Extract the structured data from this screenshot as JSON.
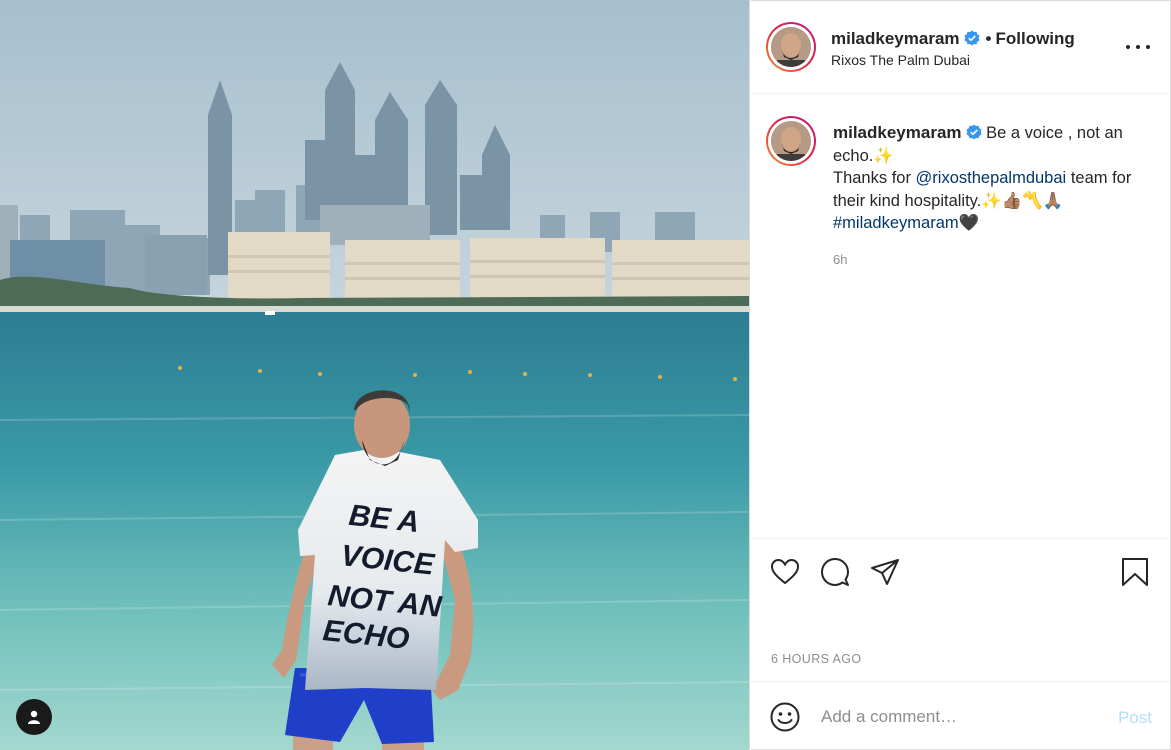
{
  "post": {
    "username": "miladkeymaram",
    "follow_sep": "•",
    "follow_status": "Following",
    "location": "Rixos The Palm Dubai",
    "caption_line1": "Be a voice , not an echo.",
    "caption_emoji1": "✨",
    "caption_thanks_prefix": "Thanks for",
    "caption_mention": "@rixosthepalmdubai",
    "caption_thanks_suffix": "team for their kind hospitality.",
    "caption_emoji2": "✨👍🏽〽️🙏🏽",
    "caption_hashtag": "#miladkeymaram",
    "caption_heart": "🖤",
    "caption_time": "6h",
    "date_label": "6 HOURS AGO"
  },
  "photo": {
    "shirt_text": [
      "BE A",
      "VOICE",
      "NOT AN",
      "ECHO"
    ]
  },
  "comment": {
    "placeholder": "Add a comment…",
    "post_label": "Post"
  },
  "icons": {
    "verified": "verified-badge-icon",
    "more": "more-options-icon",
    "like": "heart-icon",
    "comment": "comment-bubble-icon",
    "share": "paper-plane-icon",
    "save": "bookmark-icon",
    "emoji": "smiley-icon",
    "tag": "user-tag-icon"
  },
  "colors": {
    "verified": "#3897f0",
    "link": "#00376b",
    "muted": "#8e8e8e",
    "post_disabled": "#b2dffc"
  }
}
